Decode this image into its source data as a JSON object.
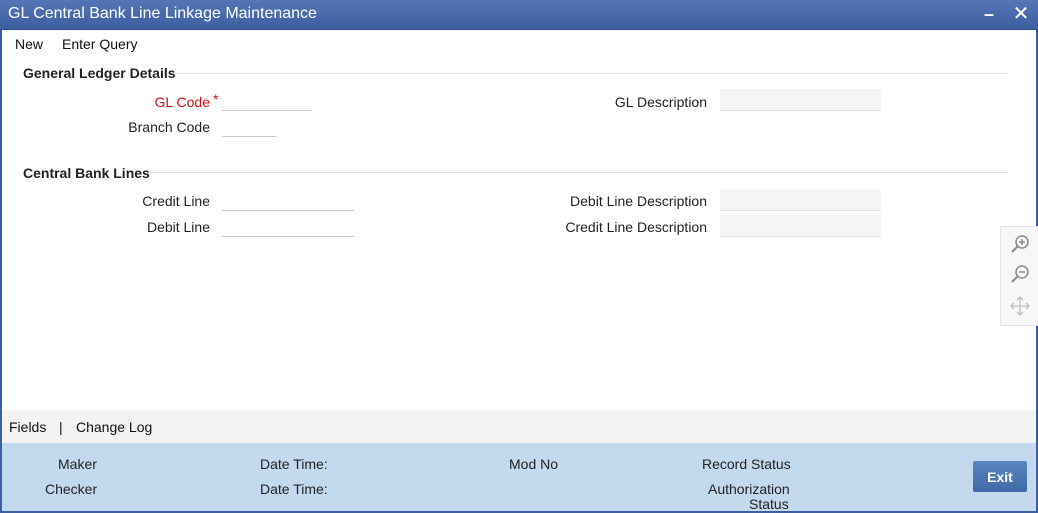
{
  "window": {
    "title": "GL Central Bank Line Linkage Maintenance",
    "minimize_glyph": "–",
    "close_glyph": "✕"
  },
  "toolbar": {
    "new_label": "New",
    "enter_query_label": "Enter Query"
  },
  "gl_section": {
    "title": "General Ledger Details",
    "gl_code_label": "GL Code",
    "required_marker": "*",
    "gl_code_value": "",
    "branch_code_label": "Branch Code",
    "branch_code_value": "",
    "gl_description_label": "GL Description",
    "gl_description_value": ""
  },
  "cb_section": {
    "title": "Central Bank Lines",
    "credit_line_label": "Credit Line",
    "credit_line_value": "",
    "debit_line_label": "Debit Line",
    "debit_line_value": "",
    "debit_line_description_label": "Debit Line Description",
    "debit_line_description_value": "",
    "credit_line_description_label": "Credit Line Description",
    "credit_line_description_value": ""
  },
  "zoom_panel": {
    "icons": [
      "zoom-in-icon",
      "zoom-out-icon",
      "move-icon"
    ]
  },
  "footer_tabs": {
    "fields_label": "Fields",
    "separator": "|",
    "change_log_label": "Change Log"
  },
  "audit": {
    "maker_label": "Maker",
    "checker_label": "Checker",
    "date_time_label_1": "Date Time:",
    "date_time_label_2": "Date Time:",
    "mod_no_label": "Mod No",
    "record_status_label": "Record Status",
    "authorization_label_line1": "Authorization",
    "authorization_label_line2": "Status",
    "exit_label": "Exit"
  },
  "colors": {
    "title_bar": "#3d5e9f",
    "audit_bar": "#c2d9ee",
    "required": "#d01010",
    "exit_button": "#4a76b0"
  }
}
